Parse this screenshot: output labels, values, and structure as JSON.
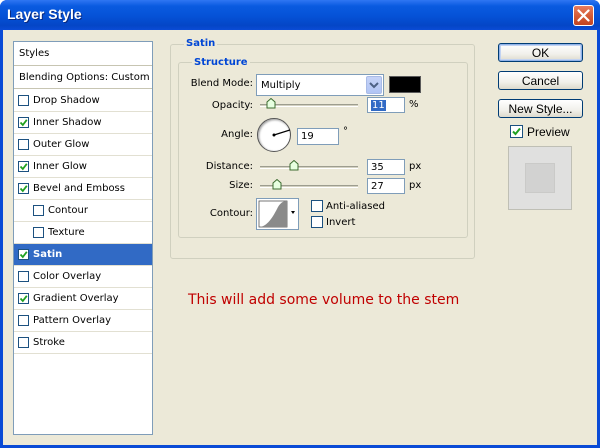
{
  "window": {
    "title": "Layer Style"
  },
  "styles_panel": {
    "header": "Styles",
    "blending_options": "Blending Options: Custom",
    "items": [
      {
        "label": "Drop Shadow",
        "checked": false,
        "indent": false,
        "selected": false
      },
      {
        "label": "Inner Shadow",
        "checked": true,
        "indent": false,
        "selected": false
      },
      {
        "label": "Outer Glow",
        "checked": false,
        "indent": false,
        "selected": false
      },
      {
        "label": "Inner Glow",
        "checked": true,
        "indent": false,
        "selected": false
      },
      {
        "label": "Bevel and Emboss",
        "checked": true,
        "indent": false,
        "selected": false
      },
      {
        "label": "Contour",
        "checked": false,
        "indent": true,
        "selected": false
      },
      {
        "label": "Texture",
        "checked": false,
        "indent": true,
        "selected": false
      },
      {
        "label": "Satin",
        "checked": true,
        "indent": false,
        "selected": true
      },
      {
        "label": "Color Overlay",
        "checked": false,
        "indent": false,
        "selected": false
      },
      {
        "label": "Gradient Overlay",
        "checked": true,
        "indent": false,
        "selected": false
      },
      {
        "label": "Pattern Overlay",
        "checked": false,
        "indent": false,
        "selected": false
      },
      {
        "label": "Stroke",
        "checked": false,
        "indent": false,
        "selected": false
      }
    ]
  },
  "satin": {
    "section_title": "Satin",
    "structure_title": "Structure",
    "blend_mode_label": "Blend Mode:",
    "blend_mode_value": "Multiply",
    "blend_color": "#000000",
    "opacity_label": "Opacity:",
    "opacity_value": "11",
    "opacity_unit": "%",
    "angle_label": "Angle:",
    "angle_value": "19",
    "angle_unit": "°",
    "distance_label": "Distance:",
    "distance_value": "35",
    "distance_unit": "px",
    "size_label": "Size:",
    "size_value": "27",
    "size_unit": "px",
    "contour_label": "Contour:",
    "anti_aliased_label": "Anti-aliased",
    "anti_aliased_checked": false,
    "invert_label": "Invert",
    "invert_checked": false
  },
  "buttons": {
    "ok": "OK",
    "cancel": "Cancel",
    "new_style": "New Style...",
    "preview_label": "Preview",
    "preview_checked": true
  },
  "annotation": "This will add some volume to the stem"
}
